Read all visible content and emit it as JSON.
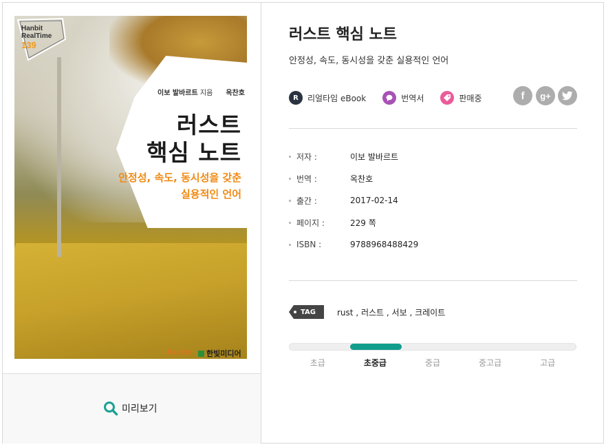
{
  "book": {
    "title": "러스트 핵심 노트",
    "subtitle": "안정성, 속도, 동시성을 갖춘 실용적인 언어"
  },
  "cover": {
    "series_line1": "Hanbit",
    "series_line2": "RealTime",
    "series_number": "139",
    "author": "이보 발바르트",
    "author_role": "지음",
    "translator": "옥찬호",
    "translator_role": "옮김",
    "title_line1": "러스트",
    "title_line2": "핵심 노트",
    "subtitle_line1": "안정성, 속도, 동시성을 갖춘",
    "subtitle_line2": "실용적인 언어",
    "publisher_packt": "Packt>",
    "publisher": "한빛미디어"
  },
  "preview": {
    "label": "미리보기",
    "icon": "magnifier-icon"
  },
  "badges": [
    {
      "label": "리얼타임 eBook",
      "icon": "R",
      "color": "#2a3340"
    },
    {
      "label": "번역서",
      "icon": "translate-icon",
      "color": "#a852b6"
    },
    {
      "label": "판매중",
      "icon": "tag-icon",
      "color": "#ea5b9a"
    }
  ],
  "social": {
    "facebook": "f",
    "google_plus": "g+",
    "twitter": "twitter-icon"
  },
  "meta": {
    "author": {
      "key": "저자 :",
      "value": "이보 발바르트"
    },
    "translator": {
      "key": "번역 :",
      "value": "옥찬호"
    },
    "published": {
      "key": "출간 :",
      "value": "2017-02-14"
    },
    "pages": {
      "key": "페이지 :",
      "value": "229 쪽"
    },
    "isbn": {
      "key": "ISBN :",
      "value": "9788968488429"
    }
  },
  "tags": {
    "label": "TAG",
    "items": [
      "rust",
      "러스트",
      "서보",
      "크레이트"
    ]
  },
  "level": {
    "options": [
      "초급",
      "초중급",
      "중급",
      "중고급",
      "고급"
    ],
    "selected_index": 1,
    "accent": "#109d8c"
  }
}
